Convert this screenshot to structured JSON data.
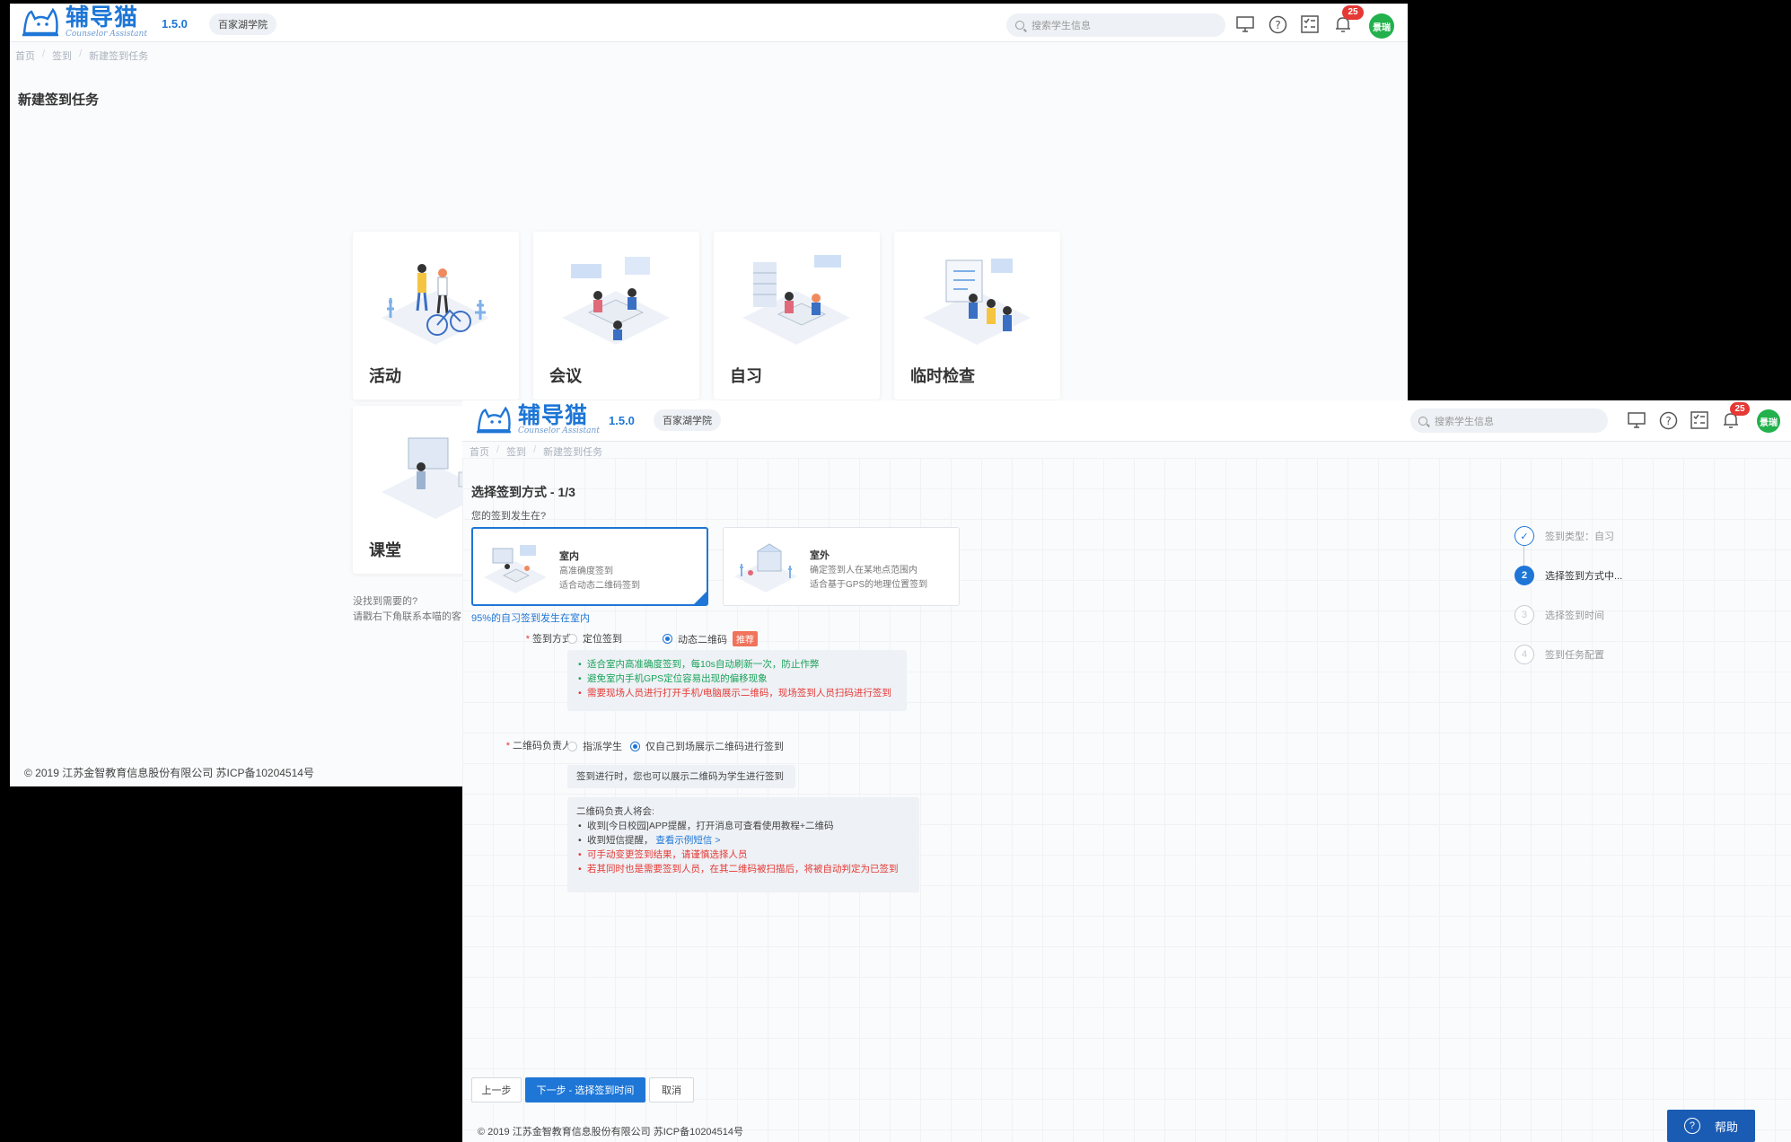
{
  "header": {
    "logo_name": "辅导猫",
    "logo_sub": "Counselor Assistant",
    "version": "1.5.0",
    "college": "百家湖学院",
    "search_placeholder": "搜索学生信息",
    "notification_count": "25",
    "avatar_text": "景瑞",
    "icons": [
      "monitor-icon",
      "help-circle-icon",
      "task-list-icon",
      "bell-icon"
    ]
  },
  "window1": {
    "breadcrumb": [
      "首页",
      "签到",
      "新建签到任务"
    ],
    "page_title": "新建签到任务",
    "cards": [
      {
        "label": "活动",
        "icon": "activity-illustration"
      },
      {
        "label": "会议",
        "icon": "meeting-illustration"
      },
      {
        "label": "自习",
        "icon": "self-study-illustration"
      },
      {
        "label": "临时检查",
        "icon": "temporary-check-illustration"
      },
      {
        "label": "课堂",
        "icon": "classroom-illustration"
      }
    ],
    "help_lines": [
      "没找到需要的?",
      "请戳右下角联系本喵的客"
    ],
    "footer": "© 2019 江苏金智教育信息股份有限公司 苏ICP备10204514号"
  },
  "window2": {
    "breadcrumb": [
      "首页",
      "签到",
      "新建签到任务"
    ],
    "step_title": "选择签到方式 - 1/3",
    "question": "您的签到发生在?",
    "modes": [
      {
        "title": "室内",
        "line1": "高准确度签到",
        "line2": "适合动态二维码签到",
        "selected": true
      },
      {
        "title": "室外",
        "line1": "确定签到人在某地点范围内",
        "line2": "适合基于GPS的地理位置签到",
        "selected": false
      }
    ],
    "stat_note": "95%的自习签到发生在室内",
    "signin_method": {
      "label": "签到方式",
      "options": [
        "定位签到",
        "动态二维码"
      ],
      "selected": "动态二维码",
      "tag": "推荐",
      "tips": [
        {
          "text": "适合室内高准确度签到，每10s自动刷新一次，防止作弊",
          "color": "green"
        },
        {
          "text": "避免室内手机GPS定位容易出现的偏移现象",
          "color": "green"
        },
        {
          "text": "需要现场人员进行打开手机/电脑展示二维码，现场签到人员扫码进行签到",
          "color": "red"
        }
      ]
    },
    "qr_owner": {
      "label": "二维码负责人",
      "options": [
        "指派学生",
        "仅自己到场展示二维码进行签到"
      ],
      "selected": "仅自己到场展示二维码进行签到",
      "hint": "签到进行时，您也可以展示二维码为学生进行签到",
      "box_title": "二维码负责人将会:",
      "items": [
        {
          "text": "收到[今日校园]APP提醒，打开消息可查看使用教程+二维码",
          "color": "dark"
        },
        {
          "text": "收到短信提醒，",
          "link": "查看示例短信 >",
          "color": "dark"
        },
        {
          "text": "可手动变更签到结果，请谨慎选择人员",
          "color": "red"
        },
        {
          "text": "若其同时也是需要签到人员，在其二维码被扫描后，将被自动判定为已签到",
          "color": "red"
        }
      ]
    },
    "steps": [
      {
        "num": "✓",
        "label": "签到类型：自习",
        "state": "done"
      },
      {
        "num": "2",
        "label": "选择签到方式中...",
        "state": "current"
      },
      {
        "num": "3",
        "label": "选择签到时间",
        "state": "todo"
      },
      {
        "num": "4",
        "label": "签到任务配置",
        "state": "todo"
      }
    ],
    "buttons": {
      "prev": "上一步",
      "next": "下一步 - 选择签到时间",
      "cancel": "取消"
    },
    "help_button": "帮助",
    "footer": "© 2019 江苏金智教育信息股份有限公司 苏ICP备10204514号"
  },
  "colors": {
    "brand": "#1e76d6",
    "success": "#19a35a",
    "danger": "#e53935",
    "avatar": "#22b14c"
  }
}
